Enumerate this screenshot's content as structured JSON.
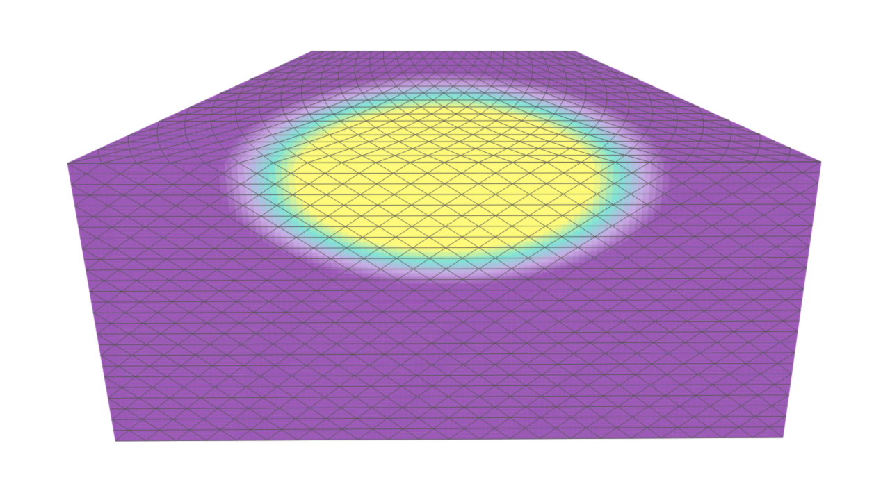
{
  "scene": {
    "background": "#ffffff",
    "surface": {
      "kind": "triangulated-mesh",
      "shading": "scalar-colormap",
      "colormap": [
        "#9b59b6",
        "#c9a9e4",
        "#7fe3d6",
        "#fffa7a"
      ],
      "base_color": "#9b59b6",
      "peak_color": "#fffa7a",
      "wireframe": true,
      "wireframe_color": "#555555"
    }
  }
}
